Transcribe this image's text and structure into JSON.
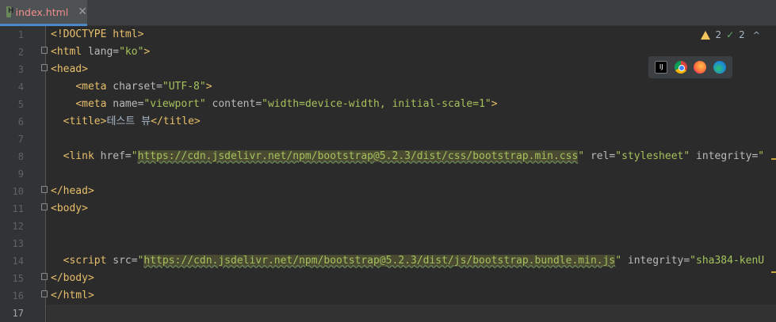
{
  "tab": {
    "filename": "index.html",
    "close": "✕"
  },
  "inspections": {
    "warnings": "2",
    "weak_warnings": "2",
    "chevron": "^"
  },
  "browser_bar": {
    "icons": [
      "intellij-icon",
      "chrome-icon",
      "firefox-icon",
      "edge-icon"
    ],
    "ij_text": "IJ"
  },
  "gutter": {
    "line_numbers": [
      "1",
      "2",
      "3",
      "4",
      "5",
      "6",
      "7",
      "8",
      "9",
      "10",
      "11",
      "12",
      "13",
      "14",
      "15",
      "16",
      "17"
    ]
  },
  "code": {
    "l1": "<!DOCTYPE html>",
    "l2_tag": "<html ",
    "l2_attr": "lang=",
    "l2_val": "\"ko\"",
    "l2_end": ">",
    "l3": "<head>",
    "l4_tag": "<meta ",
    "l4_attr": "charset=",
    "l4_val": "\"UTF-8\"",
    "l4_end": ">",
    "l5_tag": "<meta ",
    "l5_attr1": "name=",
    "l5_val1": "\"viewport\"",
    "l5_attr2": " content=",
    "l5_val2": "\"width=device-width, initial-scale=1\"",
    "l5_end": ">",
    "l6_open": "<title>",
    "l6_text": "테스트 뷰",
    "l6_close": "</title>",
    "l8_tag": "<link ",
    "l8_attr1": "href=",
    "l8_q": "\"",
    "l8_url": "https://cdn.jsdelivr.net/npm/bootstrap@5.2.3/dist/css/bootstrap.min.css",
    "l8_q2": "\"",
    "l8_attr2": " rel=",
    "l8_val2": "\"stylesheet\"",
    "l8_attr3": " integrity=",
    "l8_val3": "\"",
    "l10": "</head>",
    "l11": "<body>",
    "l14_tag": "<script ",
    "l14_attr1": "src=",
    "l14_q": "\"",
    "l14_url": "https://cdn.jsdelivr.net/npm/bootstrap@5.2.3/dist/js/bootstrap.bundle.min.js",
    "l14_q2": "\"",
    "l14_attr2": " integrity=",
    "l14_val2": "\"sha384-kenU",
    "l15": "</body>",
    "l16": "</html>"
  },
  "colors": {
    "editor_bg": "#2b2b2b",
    "tag": "#e8bf6a",
    "string": "#a5c25c",
    "attribute": "#bababa",
    "tab_filename": "#f08d8d",
    "warning": "#f2c55c"
  }
}
